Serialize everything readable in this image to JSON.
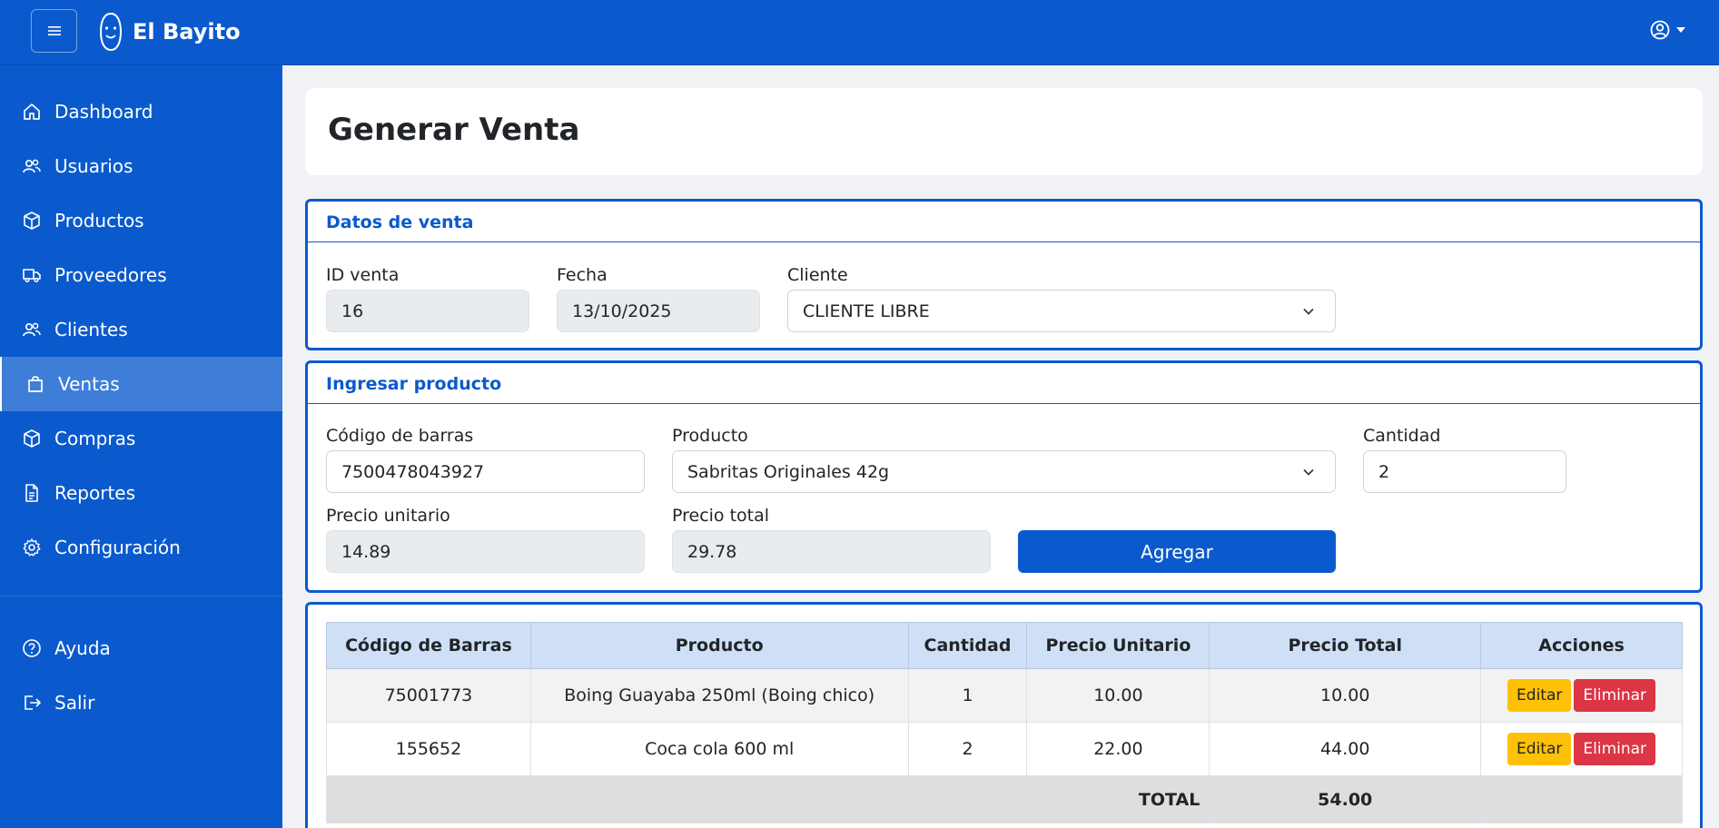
{
  "app": {
    "name": "El Bayito"
  },
  "sidebar": {
    "items": [
      {
        "label": "Dashboard",
        "icon": "home-icon"
      },
      {
        "label": "Usuarios",
        "icon": "users-icon"
      },
      {
        "label": "Productos",
        "icon": "box-icon"
      },
      {
        "label": "Proveedores",
        "icon": "truck-icon"
      },
      {
        "label": "Clientes",
        "icon": "users-icon"
      },
      {
        "label": "Ventas",
        "icon": "shopping-bag-icon",
        "active": true
      },
      {
        "label": "Compras",
        "icon": "box-icon"
      },
      {
        "label": "Reportes",
        "icon": "file-icon"
      },
      {
        "label": "Configuración",
        "icon": "gear-icon"
      }
    ],
    "bottom_items": [
      {
        "label": "Ayuda",
        "icon": "help-icon"
      },
      {
        "label": "Salir",
        "icon": "logout-icon"
      }
    ]
  },
  "page": {
    "title": "Generar Venta"
  },
  "sale_data": {
    "heading": "Datos de venta",
    "id_label": "ID venta",
    "id_value": "16",
    "date_label": "Fecha",
    "date_value": "13/10/2025",
    "client_label": "Cliente",
    "client_value": "CLIENTE LIBRE"
  },
  "product_entry": {
    "heading": "Ingresar producto",
    "barcode_label": "Código de barras",
    "barcode_value": "7500478043927",
    "product_label": "Producto",
    "product_value": "Sabritas Originales 42g",
    "qty_label": "Cantidad",
    "qty_value": "2",
    "unit_price_label": "Precio unitario",
    "unit_price_value": "14.89",
    "total_price_label": "Precio total",
    "total_price_value": "29.78",
    "add_button": "Agregar"
  },
  "table": {
    "headers": [
      "Código de Barras",
      "Producto",
      "Cantidad",
      "Precio Unitario",
      "Precio Total",
      "Acciones"
    ],
    "rows": [
      {
        "barcode": "75001773",
        "product": "Boing Guayaba 250ml (Boing chico)",
        "qty": "1",
        "unit": "10.00",
        "total": "10.00"
      },
      {
        "barcode": "155652",
        "product": "Coca cola 600 ml",
        "qty": "2",
        "unit": "22.00",
        "total": "44.00"
      }
    ],
    "edit_label": "Editar",
    "delete_label": "Eliminar",
    "total_label": "TOTAL",
    "total_value": "54.00"
  },
  "colors": {
    "primary": "#0b5acd",
    "warning": "#ffc107",
    "danger": "#dc3545"
  }
}
